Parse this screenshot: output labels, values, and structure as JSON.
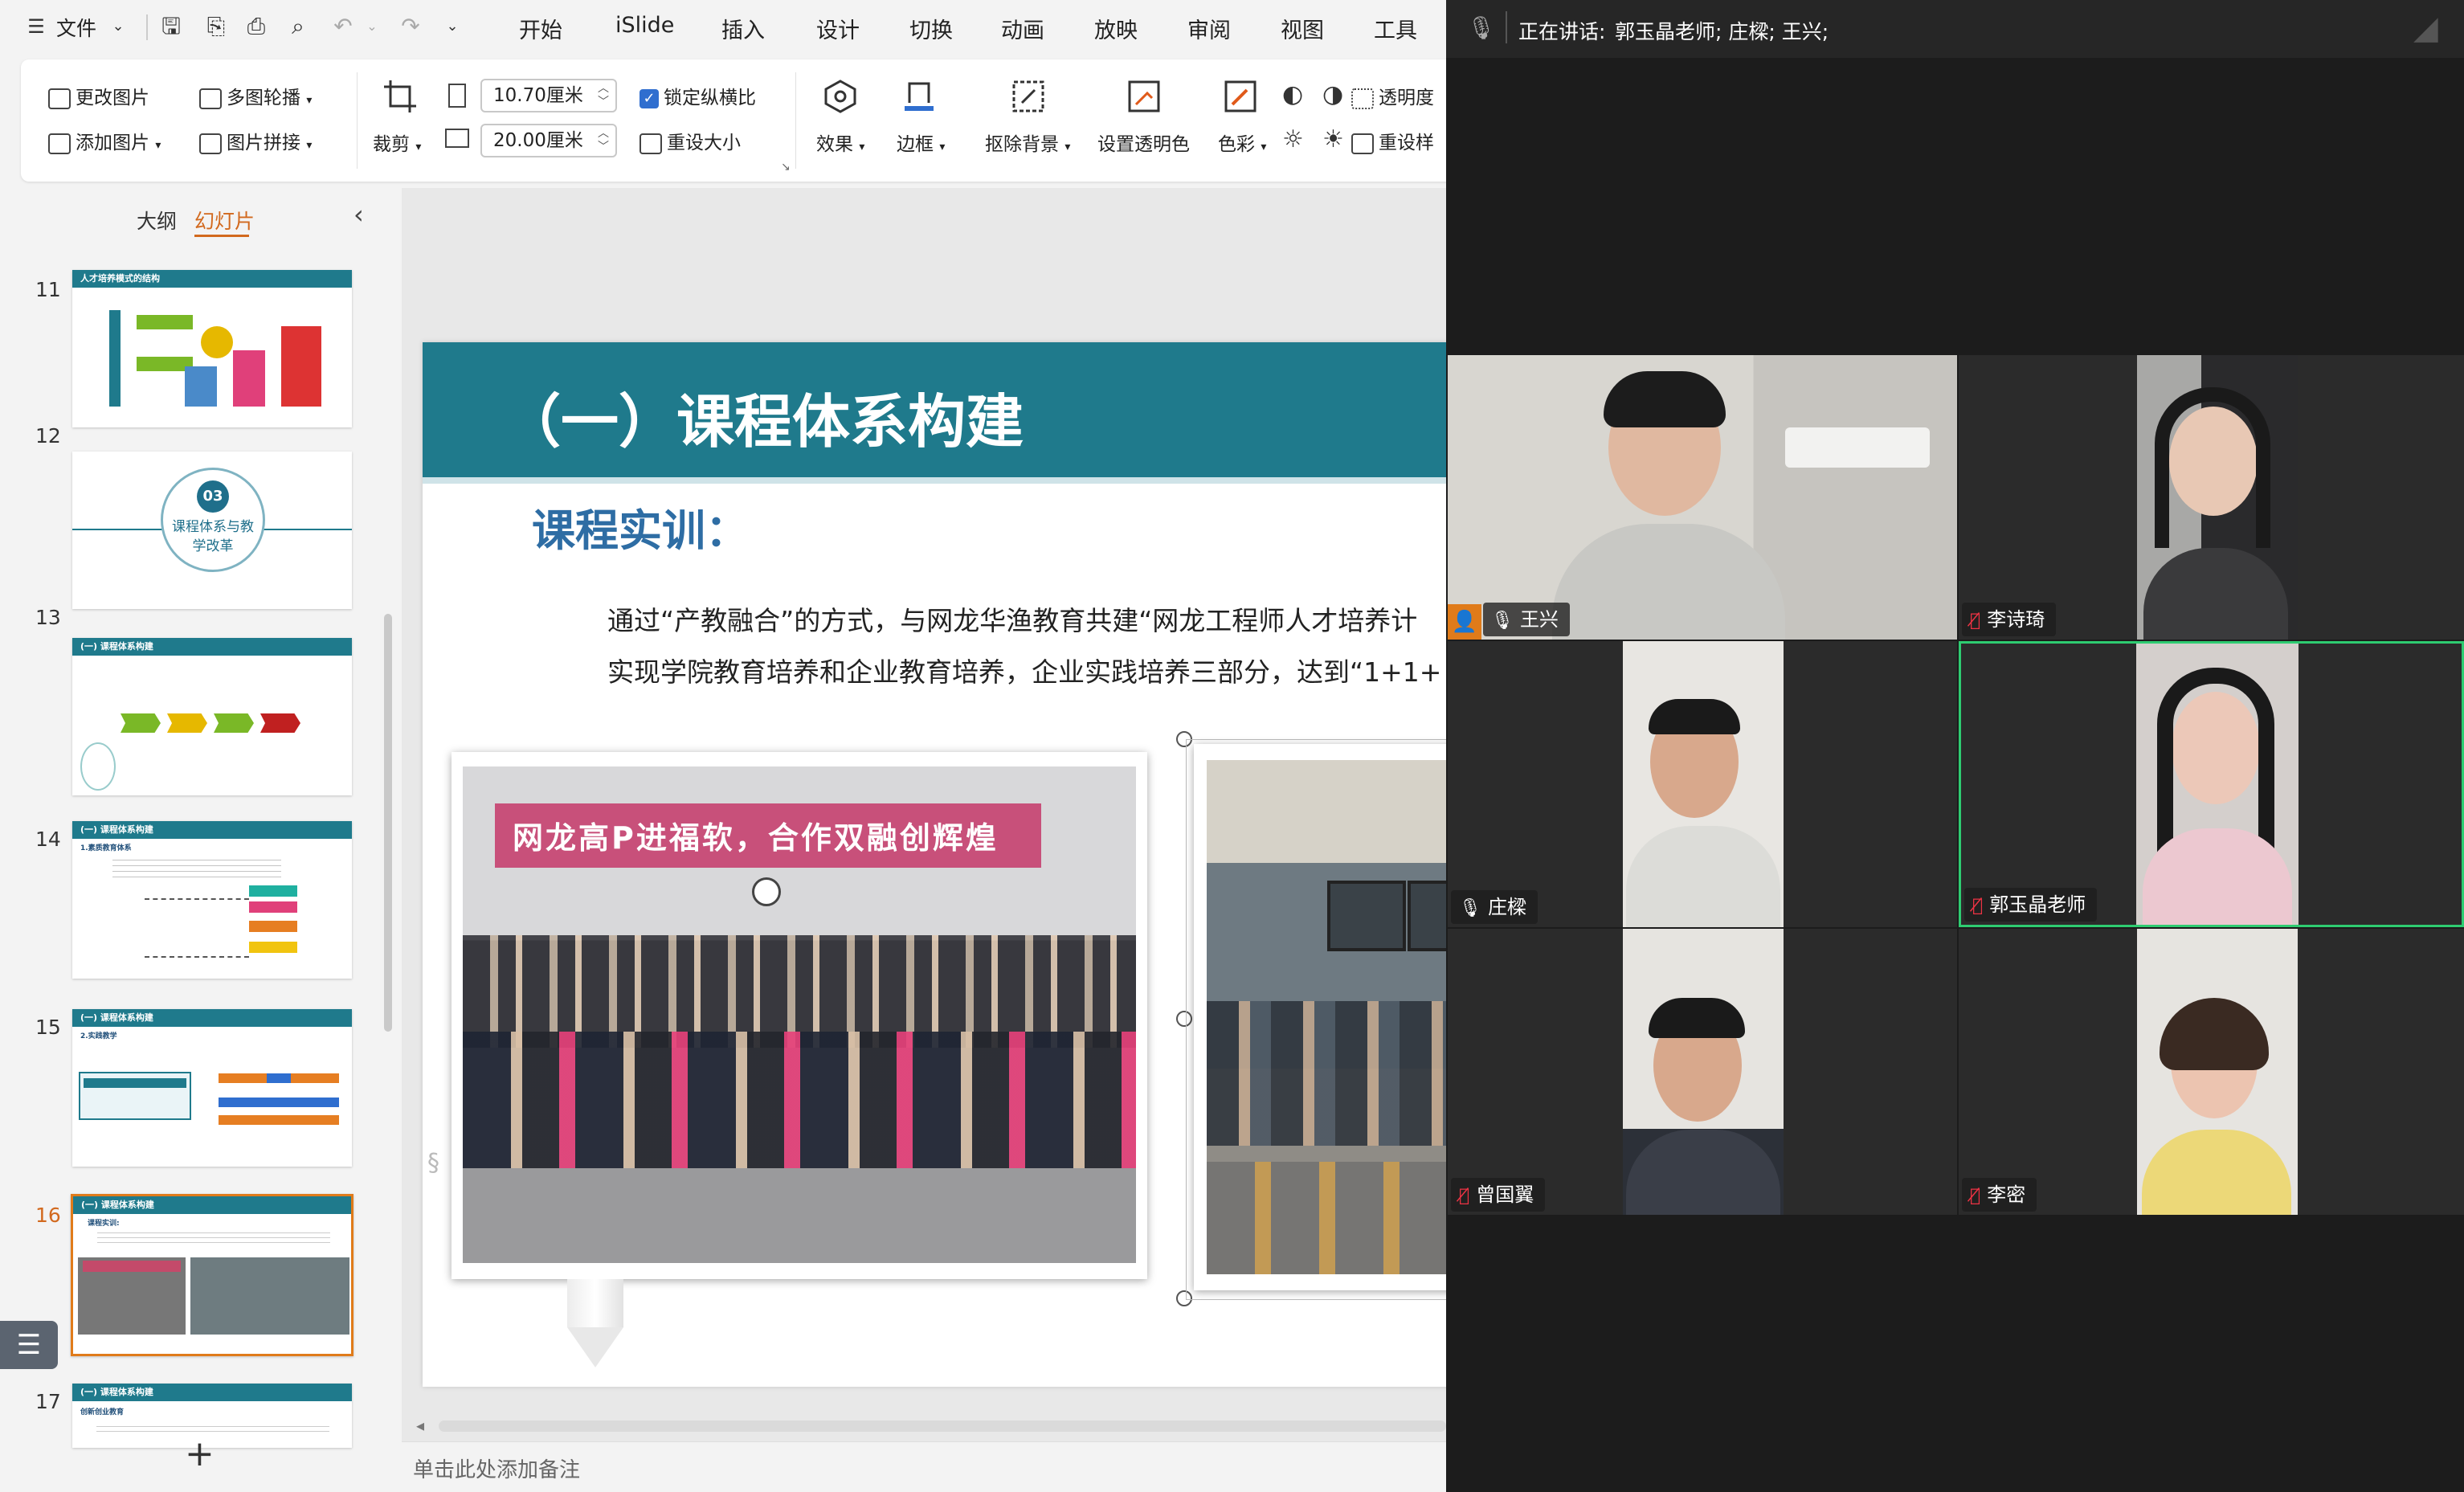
{
  "ppt": {
    "file_menu": "文件",
    "menus": [
      "开始",
      "iSlide",
      "插入",
      "设计",
      "切换",
      "动画",
      "放映",
      "审阅",
      "视图",
      "工具"
    ],
    "ribbon": {
      "change_picture": "更改图片",
      "add_picture": "添加图片",
      "multi_carousel": "多图轮播",
      "picture_collage": "图片拼接",
      "crop": "裁剪",
      "width": "10.70厘米",
      "height": "20.00厘米",
      "lock_ratio": "锁定纵横比",
      "reset_size": "重设大小",
      "effects": "效果",
      "border": "边框",
      "remove_bg": "抠除背景",
      "set_transparent": "设置透明色",
      "color": "色彩",
      "transparency": "透明度",
      "reset_style": "重设样"
    },
    "panel_tabs": {
      "outline": "大纲",
      "slides": "幻灯片"
    },
    "thumbnails": [
      {
        "num": "11",
        "title": "人才培养模式的结构"
      },
      {
        "num": "12",
        "badge": "03",
        "title": "课程体系与教学改革"
      },
      {
        "num": "13",
        "title": "(一) 课程体系构建"
      },
      {
        "num": "14",
        "title": "(一) 课程体系构建",
        "sub": "1.素质教育体系"
      },
      {
        "num": "15",
        "title": "(一) 课程体系构建",
        "sub": "2.实践教学"
      },
      {
        "num": "16",
        "title": "(一) 课程体系构建",
        "sub": "课程实训:"
      },
      {
        "num": "17",
        "title": "(一) 课程体系构建",
        "sub": "创新创业教育"
      }
    ],
    "slide": {
      "title": "（一）课程体系构建",
      "subtitle": "课程实训：",
      "line1": "通过“产教融合”的方式，与网龙华渔教育共建“网龙工程师人才培养计",
      "line2": "实现学院教育培养和企业教育培养，企业实践培养三部分，达到“1+1+",
      "banner": "网龙高P进福软，合作双融创辉煌"
    },
    "notes_placeholder": "单击此处添加备注"
  },
  "meeting": {
    "speaking_label": "正在讲话:",
    "speakers": "郭玉晶老师; 庄樑; 王兴;",
    "participants": [
      {
        "name": "王兴",
        "muted": false,
        "host": true
      },
      {
        "name": "李诗琦",
        "muted": true
      },
      {
        "name": "庄樑",
        "muted": false
      },
      {
        "name": "郭玉晶老师",
        "muted": true,
        "active": true
      },
      {
        "name": "曾国翼",
        "muted": true
      },
      {
        "name": "李密",
        "muted": true
      }
    ]
  },
  "colors": {
    "accent_teal": "#1f7a8c",
    "title_blue": "#2e6da4",
    "active_border": "#2ecc71",
    "orange": "#e07b1a"
  }
}
